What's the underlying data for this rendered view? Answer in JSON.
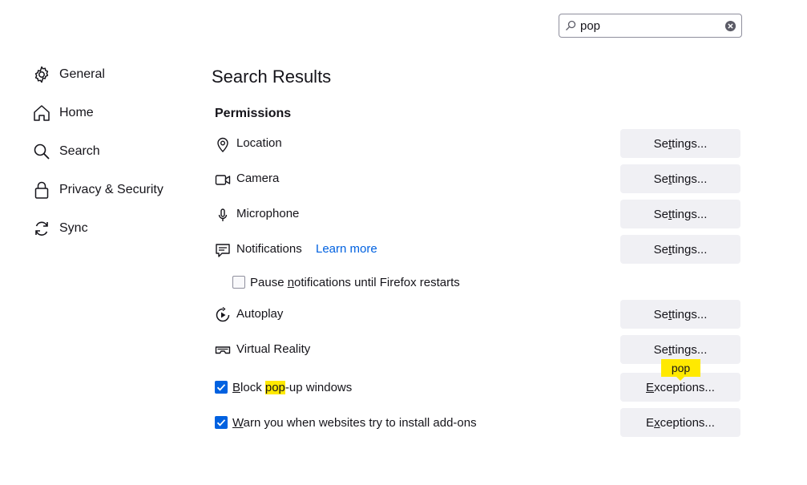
{
  "search": {
    "value": "pop",
    "search_icon": "search-icon",
    "clear_icon": "clear-icon"
  },
  "sidebar": {
    "items": [
      {
        "label": "General",
        "icon": "gear-icon"
      },
      {
        "label": "Home",
        "icon": "home-icon"
      },
      {
        "label": "Search",
        "icon": "search-icon"
      },
      {
        "label": "Privacy & Security",
        "icon": "lock-icon"
      },
      {
        "label": "Sync",
        "icon": "sync-icon"
      }
    ]
  },
  "main": {
    "title": "Search Results",
    "section": "Permissions",
    "permissions": [
      {
        "label": "Location",
        "icon": "location-pin-icon",
        "button": "Settings..."
      },
      {
        "label": "Camera",
        "icon": "camera-icon",
        "button": "Settings..."
      },
      {
        "label": "Microphone",
        "icon": "microphone-icon",
        "button": "Settings..."
      },
      {
        "label": "Notifications",
        "icon": "notifications-icon",
        "button": "Settings...",
        "link": "Learn more"
      },
      {
        "label": "Autoplay",
        "icon": "autoplay-icon",
        "button": "Settings..."
      },
      {
        "label": "Virtual Reality",
        "icon": "vr-headset-icon",
        "button": "Settings..."
      }
    ],
    "pause_notifications": {
      "label": "Pause notifications until Firefox restarts",
      "checked": false
    },
    "block_popups": {
      "label_pre": "Block ",
      "label_highlight": "pop",
      "label_post": "-up windows",
      "checked": true,
      "button": "Exceptions..."
    },
    "warn_addons": {
      "label": "Warn you when websites try to install add-ons",
      "checked": true,
      "button": "Exceptions..."
    },
    "tooltip": "pop"
  },
  "colors": {
    "accent": "#0061e0",
    "highlight": "#ffe900",
    "button_bg": "#f0f0f4"
  }
}
